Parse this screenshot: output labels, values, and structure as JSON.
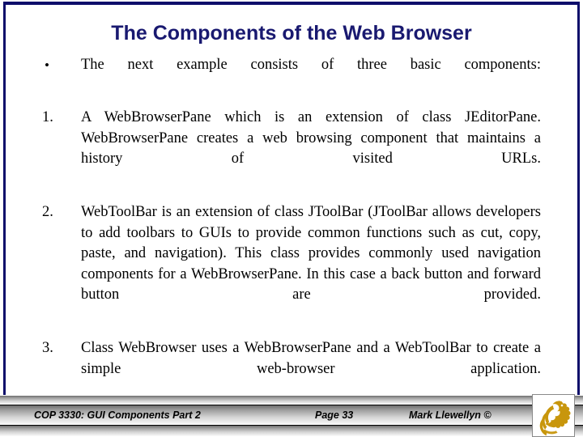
{
  "slide": {
    "title": "The Components of the Web Browser",
    "accent_color": "#191970",
    "background_color": "#ffffff",
    "body": [
      {
        "marker": "•",
        "marker_type": "bullet",
        "text": "The next example consists of three basic components:"
      },
      {
        "marker": "1.",
        "marker_type": "number",
        "text": "A WebBrowserPane which is an extension of class JEditorPane.  WebBrowserPane creates a web browsing component that maintains a history of visited URLs."
      },
      {
        "marker": "2.",
        "marker_type": "number",
        "text": "WebToolBar is an extension of class JToolBar (JToolBar allows developers to add toolbars to GUIs to provide common functions such as cut, copy, paste, and navigation).   This class provides commonly used navigation components for a WebBrowserPane.  In this case a back button and forward button are provided."
      },
      {
        "marker": "3.",
        "marker_type": "number",
        "text": "Class WebBrowser uses a WebBrowserPane and a WebToolBar to create a simple web-browser application."
      }
    ]
  },
  "footer": {
    "course": "COP 3330: GUI Components Part 2",
    "page": "Page 33",
    "author": "Mark Llewellyn ©",
    "logo_name": "ucf-pegasus-logo",
    "logo_color": "#c8960c"
  }
}
